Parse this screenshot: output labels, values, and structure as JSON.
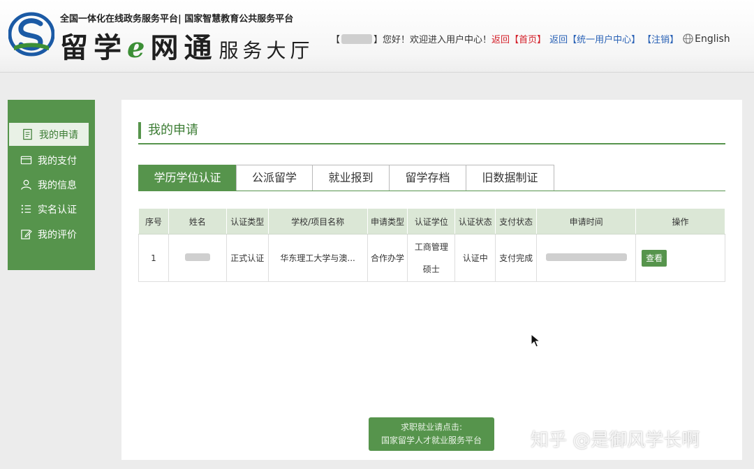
{
  "header": {
    "tagline": "全国一体化在线政务服务平台| 国家智慧教育公共服务平台",
    "logo_main": "留学",
    "logo_e": "e",
    "logo_main2": "网通",
    "logo_sub": "服务大厅",
    "bracket_open": "【",
    "bracket_close": "】",
    "greeting": "您好！欢迎进入用户中心！",
    "back_label": "返回",
    "home_link": "【首页】",
    "back_label_2": "返回",
    "unified_link": "【统一用户中心】",
    "logout_link": "【注销】",
    "language": "English"
  },
  "sidebar": {
    "items": [
      {
        "label": "我的申请",
        "icon": "document-icon",
        "active": true
      },
      {
        "label": "我的支付",
        "icon": "card-icon",
        "active": false
      },
      {
        "label": "我的信息",
        "icon": "user-icon",
        "active": false
      },
      {
        "label": "实名认证",
        "icon": "list-icon",
        "active": false
      },
      {
        "label": "我的评价",
        "icon": "edit-icon",
        "active": false
      }
    ]
  },
  "main": {
    "title": "我的申请",
    "tabs": [
      "学历学位认证",
      "公派留学",
      "就业报到",
      "留学存档",
      "旧数据制证"
    ],
    "table": {
      "headers": [
        "序号",
        "姓名",
        "认证类型",
        "学校/项目名称",
        "申请类型",
        "认证学位",
        "认证状态",
        "支付状态",
        "申请时间",
        "操作"
      ],
      "rows": [
        {
          "index": "1",
          "cert_type": "正式认证",
          "school": "华东理工大学与澳...",
          "apply_type": "合作办学",
          "degree_line1": "工商管理",
          "degree_line2": "硕士",
          "status": "认证中",
          "pay_status": "支付完成",
          "action": "查看"
        }
      ]
    },
    "job_button_line1": "求职就业请点击:",
    "job_button_line2": "国家留学人才就业服务平台"
  },
  "watermark": "知乎 @是御风学长啊",
  "colors": {
    "brand_green": "#56944c",
    "status_teal": "#23a6a6",
    "link_red": "#d4202a",
    "link_blue": "#2a62b6"
  }
}
